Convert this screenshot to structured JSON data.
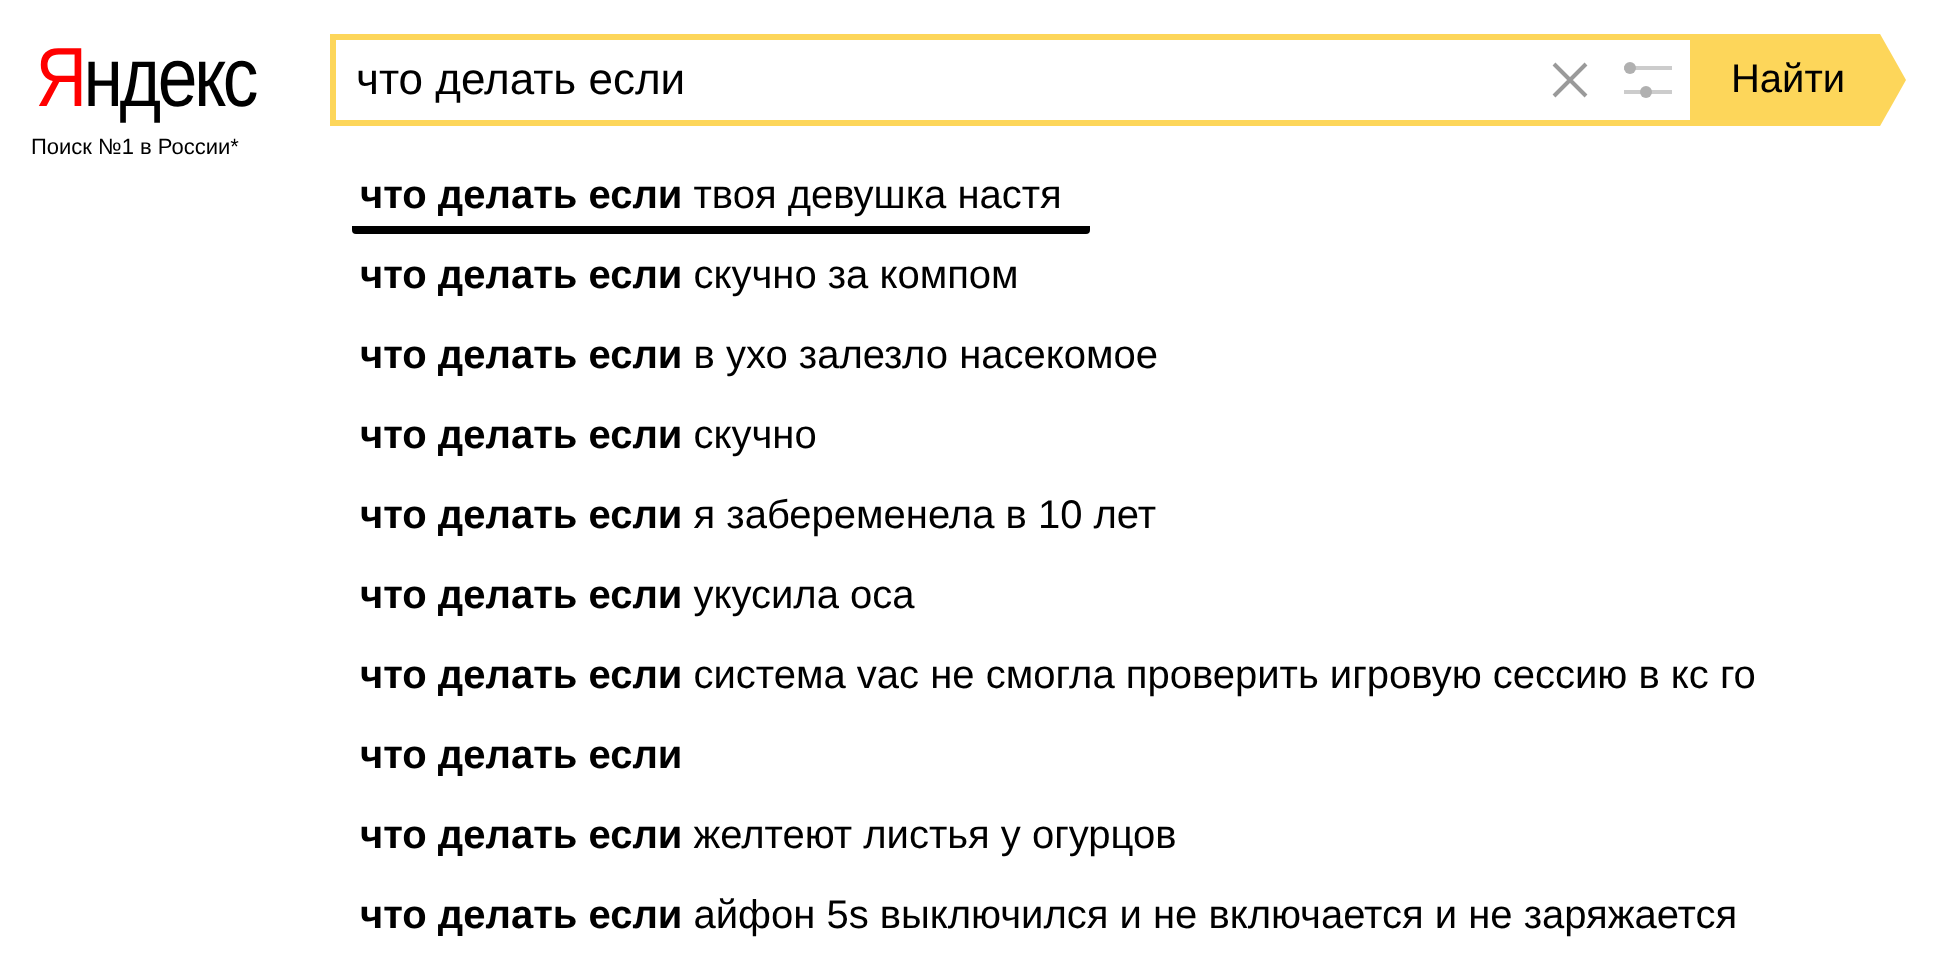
{
  "logo": {
    "name": "Яндекс",
    "tagline": "Поиск №1 в России*"
  },
  "search": {
    "value": "что делать если",
    "button": "Найти"
  },
  "suggestions": [
    {
      "text": "**что делать если** твоя девушка настя",
      "underlined": true
    },
    {
      "text": "**что делать если** скучно за компом",
      "underlined": false
    },
    {
      "text": "**что делать если** в ухо залезло насекомое",
      "underlined": false
    },
    {
      "text": "**что делать если** скучно",
      "underlined": false
    },
    {
      "text": "**что делать если** я забеременела в 10 лет",
      "underlined": false
    },
    {
      "text": "**что делать если** укусила оса",
      "underlined": false
    },
    {
      "text": "**что делать если** система vac не смогла проверить игровую сессию в кс го",
      "underlined": false
    },
    {
      "text": "**что делать если**",
      "underlined": false
    },
    {
      "text": "**что делать если** желтеют листья у огурцов",
      "underlined": false
    },
    {
      "text": "**что делать если** айфон 5s выключился и не включается и не заряжается",
      "underlined": false
    }
  ]
}
